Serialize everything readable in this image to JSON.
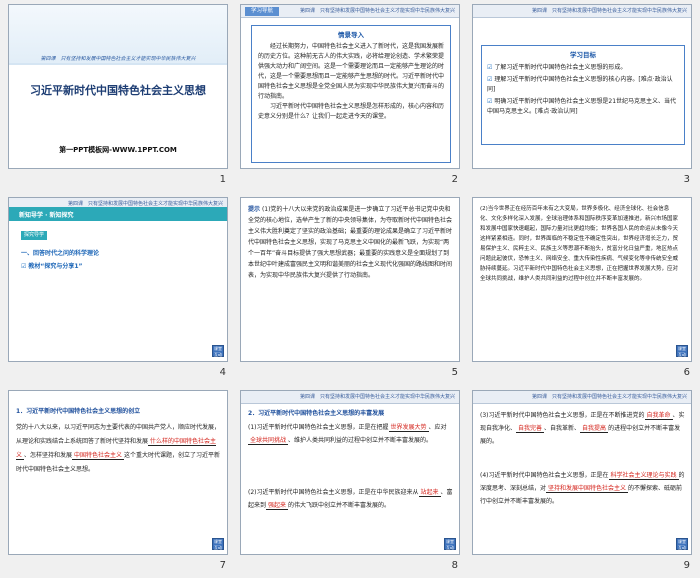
{
  "header_chapter": "第四课　只有坚持和发展中国特色社会主义才能实现中华民族伟大复兴",
  "nav_label": "课堂\n互动",
  "slides": [
    {
      "number": "1",
      "header": "第四课　只有坚持和发展中国特色社会主义才能实现中华民族伟大复兴",
      "title": "习近平新时代中国特色社会主义思想",
      "footer": "第一PPT模板网-WWW.1PPT.COM"
    },
    {
      "number": "2",
      "tag": "学习导航",
      "box_title": "情景导入",
      "paragraphs": [
        "经过长期努力，中国特色社会主义进入了新时代，这是我国发展新的历史方位。这种前无古人的伟大实践，必将给理论创造、学术繁荣提供强大动力和广阔空间。这是一个需要理论而且一定能够产生理论的时代，这是一个需要思想而且一定能够产生思想的时代。习近平新时代中国特色社会主义思想是全党全国人民为实现中华民族伟大复兴而奋斗的行动指南。",
        "习近平新时代中国特色社会主义思想是怎样形成的，核心内容和历史意义分别是什么？让我们一起走进今天的课堂。"
      ]
    },
    {
      "number": "3",
      "box_title": "学习目标",
      "goals": [
        "了解习近平新时代中国特色社会主义思想的形成。",
        "理解习近平新时代中国特色社会主义思想的核心内容。[难点·政治认同]",
        "明确习近平新时代中国特色社会主义思想是21世纪马克思主义、当代中国马克思主义。[难点·政治认同]"
      ]
    },
    {
      "number": "4",
      "bar_text": "新知导学 · 新知探究",
      "chip": "探究导学",
      "section": "一、回答时代之问的科学理论",
      "item": "教材“探究与分享1”"
    },
    {
      "number": "5",
      "lead": "提示",
      "text": "(1)党的十八大以来党的政治成果是进一步确立了习近平总书记党中央和全党的核心地位，选举产生了新的中央领导集体，为夺取新时代中国特色社会主义伟大胜利奠定了坚实的政治基础；最重要的理论成果是确立了习近平新时代中国特色社会主义思想，实现了马克思主义中国化的最新飞跃，为实现“两个一百年”奋斗目标提供了强大思想武器；最重要的实践意义是全面规划了到本世纪中叶建成富强民主文明和谐美丽的社会主义现代化强国的路线图和时间表，为实现中华民族伟大复兴提供了行动指南。"
    },
    {
      "number": "6",
      "text": "(2)当今世界正在经历百年未有之大变局，世界多极化、经济全球化、社会信息化、文化多样化深入发展，全球治理体系和国际秩序变革加速推进，新兴市场国家和发展中国家快速崛起，国际力量对比更趋均衡；世界各国人民的命运从未像今天这样紧紧相连。同时，世界面临的不稳定性不确定性突出，世界经济增长乏力，贸易保护主义、民粹主义、民族主义等思潮不断抬头，贫富分化日益严重，地区热点问题此起彼伏，恐怖主义、网络安全、重大传染性疾病、气候变化等非传统安全威胁持续蔓延。习近平新时代中国特色社会主义思想，正在把握世界发展大势，应对全球共同挑战，维护人类共同利益的过程中创立并不断丰富发展的。"
    },
    {
      "number": "7",
      "heading": "1．习近平新时代中国特色社会主义思想的创立",
      "text_a": "党的十八大以来，以习近平同志为主要代表的中国共产党人，顺应时代发展，从理论和实践结合上系统回答了新时代坚持和发展",
      "blank_a": "什么样的中国特色社会主义",
      "text_b": "、怎样坚持和发展",
      "blank_b": "中国特色社会主义",
      "text_c": "这个重大时代课题，创立了习近平新时代中国特色社会主义思想。"
    },
    {
      "number": "8",
      "heading": "2．习近平新时代中国特色社会主义思想的丰富发展",
      "p1_a": "(1)习近平新时代中国特色社会主义思想，正是在把握",
      "p1_blank1": "世界发展大势",
      "p1_b": "、应对",
      "p1_blank2": "全球共同挑战",
      "p1_c": "、维护人类共同利益的过程中创立并不断丰富发展的。",
      "p2_a": "(2)习近平新时代中国特色社会主义思想，正是在中华民族迎来从",
      "p2_blank1": "站起来",
      "p2_b": "、富起来到",
      "p2_blank2": "强起来",
      "p2_c": "的伟大飞跃中创立并不断丰富发展的。"
    },
    {
      "number": "9",
      "p3_a": "(3)习近平新时代中国特色社会主义思想，正是在不断推进党的",
      "p3_blank1": "自我革命",
      "p3_b": "、实现自我净化、",
      "p3_blank2": "自我完善",
      "p3_c": "、自我革新、",
      "p3_blank3": "自我提高",
      "p3_d": "的进程中创立并不断丰富发展的。",
      "p4_a": "(4)习近平新时代中国特色社会主义思想，正是在",
      "p4_blank1": "科学社会主义理论与实践",
      "p4_b": "的深度思考、深刻总结，对",
      "p4_blank2": "坚持和发展中国特色社会主义",
      "p4_c": "的不懈探索、砥砺前行中创立并不断丰富发展的。"
    }
  ]
}
